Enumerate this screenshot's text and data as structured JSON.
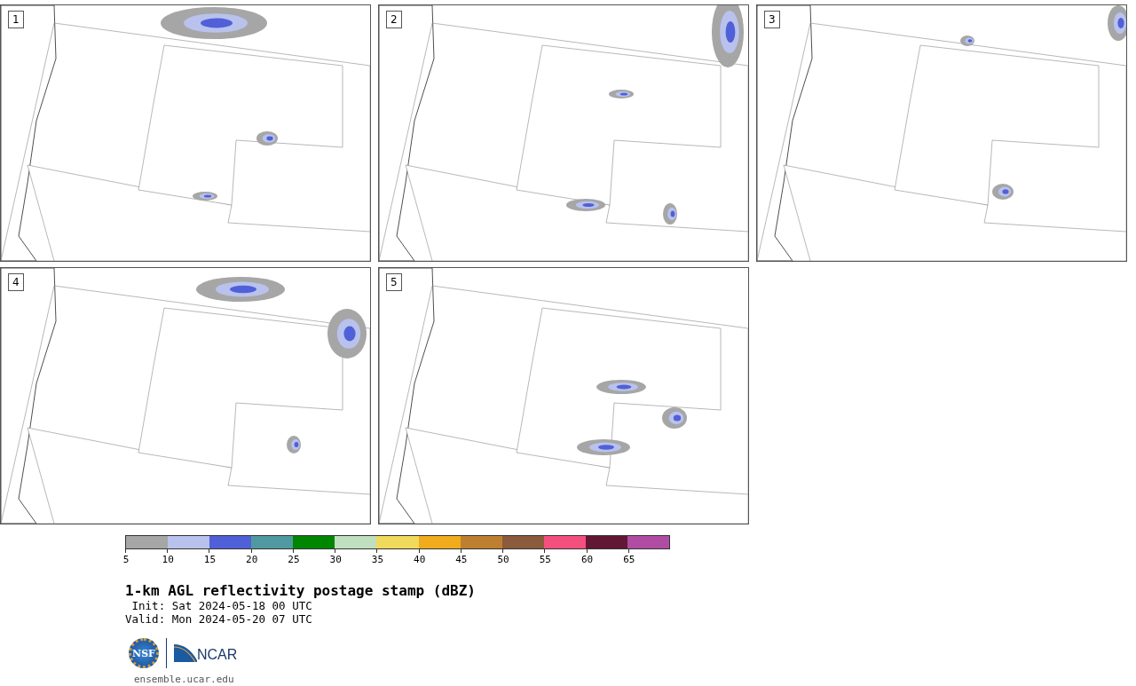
{
  "panels": [
    {
      "label": "1"
    },
    {
      "label": "2"
    },
    {
      "label": "3"
    },
    {
      "label": "4"
    },
    {
      "label": "5"
    }
  ],
  "colorbar": {
    "segments": [
      {
        "color": "#a6a6a6"
      },
      {
        "color": "#b8c2ec"
      },
      {
        "color": "#5060d8"
      },
      {
        "color": "#4f9aa0"
      },
      {
        "color": "#008600"
      },
      {
        "color": "#bfdfbf"
      },
      {
        "color": "#f0da5c"
      },
      {
        "color": "#f0ac1c"
      },
      {
        "color": "#be8030"
      },
      {
        "color": "#8c5a3c"
      },
      {
        "color": "#f4507e"
      },
      {
        "color": "#621834"
      },
      {
        "color": "#b04ca4"
      }
    ],
    "ticks": [
      "5",
      "10",
      "15",
      "20",
      "25",
      "30",
      "35",
      "40",
      "45",
      "50",
      "55",
      "60",
      "65"
    ]
  },
  "title": "1-km AGL reflectivity postage stamp (dBZ)",
  "init": " Init: Sat 2024-05-18 00 UTC",
  "valid": "Valid: Mon 2024-05-20 07 UTC",
  "logos": {
    "nsf": "NSF",
    "ncar": "NCAR"
  },
  "url": "ensemble.ucar.edu"
}
